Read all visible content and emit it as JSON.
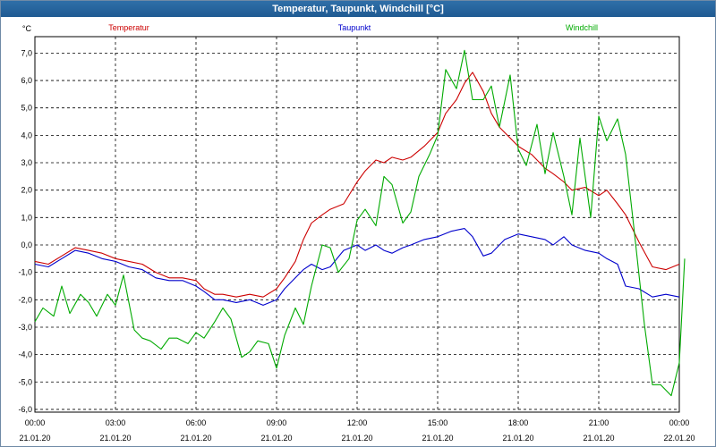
{
  "window": {
    "title": "Temperatur, Taupunkt, Windchill [°C]"
  },
  "chart_data": {
    "type": "line",
    "title": "Temperatur, Taupunkt, Windchill [°C]",
    "ylabel": "°C",
    "ylim": [
      -6.1,
      7.6
    ],
    "grid": true,
    "legend": "top",
    "y_ticks": [
      "7,0",
      "6,0",
      "5,0",
      "4,0",
      "3,0",
      "2,0",
      "1,0",
      "0,0",
      "-1,0",
      "-2,0",
      "-3,0",
      "-4,0",
      "-5,0",
      "-6,0"
    ],
    "x_ticks": [
      {
        "time": "00:00",
        "date": "21.01.20"
      },
      {
        "time": "03:00",
        "date": "21.01.20"
      },
      {
        "time": "06:00",
        "date": "21.01.20"
      },
      {
        "time": "09:00",
        "date": "21.01.20"
      },
      {
        "time": "12:00",
        "date": "21.01.20"
      },
      {
        "time": "15:00",
        "date": "21.01.20"
      },
      {
        "time": "18:00",
        "date": "21.01.20"
      },
      {
        "time": "21:00",
        "date": "21.01.20"
      },
      {
        "time": "00:00",
        "date": "22.01.20"
      }
    ],
    "x_unit": "hours since 21.01.20 00:00",
    "series": [
      {
        "name": "Temperatur",
        "color": "#cc0000",
        "points": [
          [
            0,
            -0.6
          ],
          [
            0.5,
            -0.7
          ],
          [
            1,
            -0.4
          ],
          [
            1.5,
            -0.1
          ],
          [
            2,
            -0.2
          ],
          [
            2.5,
            -0.3
          ],
          [
            3,
            -0.5
          ],
          [
            3.5,
            -0.6
          ],
          [
            4,
            -0.7
          ],
          [
            4.5,
            -1.0
          ],
          [
            5,
            -1.2
          ],
          [
            5.5,
            -1.2
          ],
          [
            6,
            -1.3
          ],
          [
            6.3,
            -1.6
          ],
          [
            6.7,
            -1.8
          ],
          [
            7,
            -1.8
          ],
          [
            7.5,
            -1.9
          ],
          [
            8,
            -1.8
          ],
          [
            8.5,
            -1.9
          ],
          [
            9,
            -1.6
          ],
          [
            9.3,
            -1.2
          ],
          [
            9.7,
            -0.6
          ],
          [
            10,
            0.2
          ],
          [
            10.3,
            0.8
          ],
          [
            10.7,
            1.1
          ],
          [
            11,
            1.3
          ],
          [
            11.5,
            1.5
          ],
          [
            12,
            2.3
          ],
          [
            12.3,
            2.7
          ],
          [
            12.7,
            3.1
          ],
          [
            13,
            3.0
          ],
          [
            13.3,
            3.2
          ],
          [
            13.7,
            3.1
          ],
          [
            14,
            3.2
          ],
          [
            14.5,
            3.6
          ],
          [
            15,
            4.1
          ],
          [
            15.3,
            4.8
          ],
          [
            15.7,
            5.3
          ],
          [
            16,
            5.9
          ],
          [
            16.3,
            6.3
          ],
          [
            16.7,
            5.6
          ],
          [
            17,
            4.8
          ],
          [
            17.3,
            4.3
          ],
          [
            17.7,
            3.9
          ],
          [
            18,
            3.6
          ],
          [
            18.5,
            3.3
          ],
          [
            19,
            2.8
          ],
          [
            19.3,
            2.6
          ],
          [
            19.7,
            2.3
          ],
          [
            20,
            2.0
          ],
          [
            20.5,
            2.1
          ],
          [
            21,
            1.8
          ],
          [
            21.3,
            2.0
          ],
          [
            21.7,
            1.5
          ],
          [
            22,
            1.1
          ],
          [
            22.5,
            0.1
          ],
          [
            23,
            -0.8
          ],
          [
            23.5,
            -0.9
          ],
          [
            24,
            -0.7
          ]
        ]
      },
      {
        "name": "Taupunkt",
        "color": "#0000cc",
        "points": [
          [
            0,
            -0.7
          ],
          [
            0.5,
            -0.8
          ],
          [
            1,
            -0.5
          ],
          [
            1.5,
            -0.2
          ],
          [
            2,
            -0.3
          ],
          [
            2.5,
            -0.5
          ],
          [
            3,
            -0.6
          ],
          [
            3.5,
            -0.8
          ],
          [
            4,
            -0.9
          ],
          [
            4.5,
            -1.2
          ],
          [
            5,
            -1.3
          ],
          [
            5.5,
            -1.3
          ],
          [
            6,
            -1.5
          ],
          [
            6.3,
            -1.7
          ],
          [
            6.7,
            -2.0
          ],
          [
            7,
            -2.0
          ],
          [
            7.5,
            -2.1
          ],
          [
            8,
            -2.0
          ],
          [
            8.5,
            -2.2
          ],
          [
            9,
            -2.0
          ],
          [
            9.3,
            -1.6
          ],
          [
            9.7,
            -1.2
          ],
          [
            10,
            -0.9
          ],
          [
            10.3,
            -0.7
          ],
          [
            10.7,
            -0.9
          ],
          [
            11,
            -0.8
          ],
          [
            11.5,
            -0.2
          ],
          [
            12,
            0.0
          ],
          [
            12.3,
            -0.2
          ],
          [
            12.7,
            0.0
          ],
          [
            13,
            -0.2
          ],
          [
            13.3,
            -0.3
          ],
          [
            13.7,
            -0.1
          ],
          [
            14,
            0.0
          ],
          [
            14.5,
            0.2
          ],
          [
            15,
            0.3
          ],
          [
            15.5,
            0.5
          ],
          [
            16,
            0.6
          ],
          [
            16.3,
            0.3
          ],
          [
            16.7,
            -0.4
          ],
          [
            17,
            -0.3
          ],
          [
            17.5,
            0.2
          ],
          [
            18,
            0.4
          ],
          [
            18.5,
            0.3
          ],
          [
            19,
            0.2
          ],
          [
            19.3,
            0.0
          ],
          [
            19.7,
            0.3
          ],
          [
            20,
            0.0
          ],
          [
            20.5,
            -0.2
          ],
          [
            21,
            -0.3
          ],
          [
            21.3,
            -0.5
          ],
          [
            21.7,
            -0.7
          ],
          [
            22,
            -1.5
          ],
          [
            22.5,
            -1.6
          ],
          [
            23,
            -1.9
          ],
          [
            23.5,
            -1.8
          ],
          [
            24,
            -1.9
          ]
        ]
      },
      {
        "name": "Windchill",
        "color": "#00aa00",
        "points": [
          [
            0,
            -2.8
          ],
          [
            0.3,
            -2.3
          ],
          [
            0.7,
            -2.6
          ],
          [
            1,
            -1.5
          ],
          [
            1.3,
            -2.5
          ],
          [
            1.7,
            -1.8
          ],
          [
            2,
            -2.1
          ],
          [
            2.3,
            -2.6
          ],
          [
            2.7,
            -1.8
          ],
          [
            3,
            -2.2
          ],
          [
            3.3,
            -1.1
          ],
          [
            3.7,
            -3.1
          ],
          [
            4,
            -3.4
          ],
          [
            4.3,
            -3.5
          ],
          [
            4.7,
            -3.8
          ],
          [
            5,
            -3.4
          ],
          [
            5.3,
            -3.4
          ],
          [
            5.7,
            -3.6
          ],
          [
            6,
            -3.2
          ],
          [
            6.3,
            -3.4
          ],
          [
            6.7,
            -2.8
          ],
          [
            7,
            -2.3
          ],
          [
            7.3,
            -2.7
          ],
          [
            7.7,
            -4.1
          ],
          [
            8,
            -3.9
          ],
          [
            8.3,
            -3.5
          ],
          [
            8.7,
            -3.6
          ],
          [
            9,
            -4.5
          ],
          [
            9.3,
            -3.3
          ],
          [
            9.7,
            -2.3
          ],
          [
            10,
            -2.9
          ],
          [
            10.3,
            -1.5
          ],
          [
            10.7,
            0.0
          ],
          [
            11,
            -0.1
          ],
          [
            11.3,
            -1.0
          ],
          [
            11.7,
            -0.5
          ],
          [
            12,
            0.9
          ],
          [
            12.3,
            1.3
          ],
          [
            12.7,
            0.7
          ],
          [
            13,
            2.5
          ],
          [
            13.3,
            2.2
          ],
          [
            13.7,
            0.8
          ],
          [
            14,
            1.2
          ],
          [
            14.3,
            2.5
          ],
          [
            14.7,
            3.3
          ],
          [
            15,
            4.0
          ],
          [
            15.3,
            6.4
          ],
          [
            15.7,
            5.7
          ],
          [
            16,
            7.1
          ],
          [
            16.3,
            5.3
          ],
          [
            16.7,
            5.3
          ],
          [
            17,
            5.8
          ],
          [
            17.3,
            4.3
          ],
          [
            17.7,
            6.2
          ],
          [
            18,
            3.5
          ],
          [
            18.3,
            2.9
          ],
          [
            18.7,
            4.4
          ],
          [
            19,
            2.6
          ],
          [
            19.3,
            4.1
          ],
          [
            19.7,
            2.5
          ],
          [
            20,
            1.1
          ],
          [
            20.3,
            3.9
          ],
          [
            20.7,
            1.0
          ],
          [
            21,
            4.7
          ],
          [
            21.3,
            3.8
          ],
          [
            21.7,
            4.6
          ],
          [
            22,
            3.3
          ],
          [
            22.3,
            0.7
          ],
          [
            22.7,
            -2.9
          ],
          [
            23,
            -5.1
          ],
          [
            23.3,
            -5.1
          ],
          [
            23.7,
            -5.5
          ],
          [
            24,
            -4.3
          ],
          [
            24.2,
            -0.5
          ]
        ]
      }
    ]
  }
}
